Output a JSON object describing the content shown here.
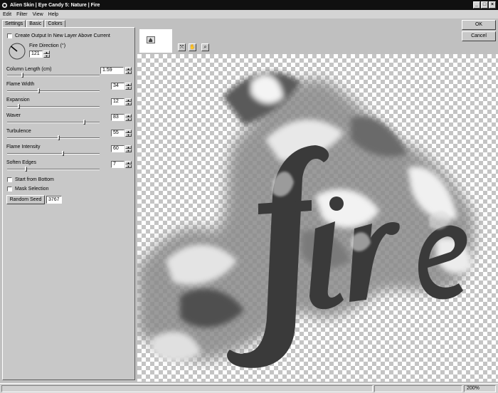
{
  "window": {
    "title": "Alien Skin | Eye Candy 5: Nature | Fire",
    "controls": {
      "minimize": "_",
      "maximize": "□",
      "close": "×"
    }
  },
  "menu": [
    "Edit",
    "Filter",
    "View",
    "Help"
  ],
  "tabs": [
    {
      "label": "Settings"
    },
    {
      "label": "Basic"
    },
    {
      "label": "Colors"
    }
  ],
  "options": {
    "create_output": "Create Output In New Layer Above Current",
    "fire_direction_label": "Fire Direction (°)",
    "fire_direction_value": "121",
    "start_from_bottom": "Start from Bottom",
    "mask_selection": "Mask Selection",
    "random_seed_button": "Random Seed",
    "random_seed_value": "3767"
  },
  "sliders": [
    {
      "label": "Column Length (cm)",
      "value": "1.59",
      "fraction": 0.16
    },
    {
      "label": "Flame Width",
      "value": "34",
      "fraction": 0.34
    },
    {
      "label": "Expansion",
      "value": "12",
      "fraction": 0.12
    },
    {
      "label": "Waver",
      "value": "83",
      "fraction": 0.83
    },
    {
      "label": "Turbulence",
      "value": "55",
      "fraction": 0.55
    },
    {
      "label": "Flame Intensity",
      "value": "60",
      "fraction": 0.6
    },
    {
      "label": "Soften Edges",
      "value": "7",
      "fraction": 0.2
    }
  ],
  "buttons": {
    "ok": "OK",
    "cancel": "Cancel"
  },
  "preview": {
    "text": "fire"
  },
  "status": {
    "zoom": "200%"
  }
}
